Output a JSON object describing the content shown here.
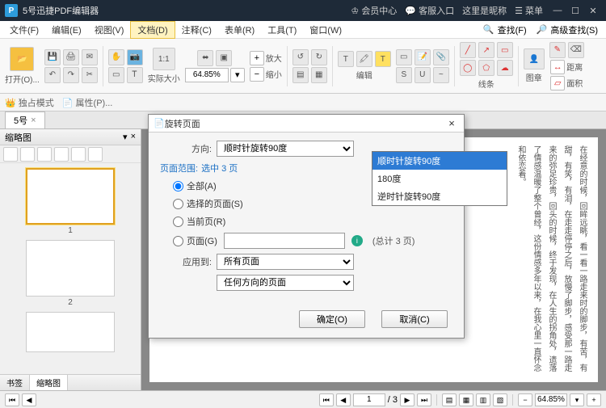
{
  "titlebar": {
    "app_title": "5号迅捷PDF编辑器",
    "member_center": "会员中心",
    "support": "客服入口",
    "nickname": "这里是昵称",
    "menu": "菜单"
  },
  "menubar": {
    "items": [
      "文件(F)",
      "编辑(E)",
      "视图(V)",
      "文档(D)",
      "注释(C)",
      "表单(R)",
      "工具(T)",
      "窗口(W)"
    ],
    "active_index": 3,
    "find": "查找(F)",
    "adv_find": "高级查找(S)"
  },
  "toolbar": {
    "open": "打开(O)...",
    "actual_size": "实际大小",
    "zoom_in": "放大",
    "zoom_out": "缩小",
    "edit": "编辑",
    "lines": "线条",
    "stamp": "图章",
    "distance": "距离",
    "area": "面积",
    "zoom_value": "64.85%"
  },
  "propbar": {
    "exclusive": "独占模式",
    "properties": "属性(P)..."
  },
  "tabs": {
    "doc": "5号"
  },
  "sidebar": {
    "title": "缩略图",
    "pages": [
      "1",
      "2"
    ],
    "foot_bookmark": "书签",
    "foot_thumbs": "缩略图"
  },
  "dialog": {
    "title": "旋转页面",
    "direction_label": "方向:",
    "direction_value": "顺时针旋转90度",
    "direction_options": [
      "顺时针旋转90度",
      "180度",
      "逆时针旋转90度"
    ],
    "range_label": "页面范围:",
    "range_info": "选中 3 页",
    "radio_all": "全部(A)",
    "radio_selected": "选择的页面(S)",
    "radio_current": "当前页(R)",
    "radio_pages": "页面(G)",
    "count_text": "(总计 3 页)",
    "apply_label": "应用到:",
    "apply_all_pages": "所有页面",
    "apply_orientation": "任何方向的页面",
    "ok": "确定(O)",
    "cancel": "取消(C)"
  },
  "statusbar": {
    "page_current": "1",
    "page_total": "/ 3",
    "zoom": "64.85%"
  },
  "doc_text": "在经意的时候，回眸远眺，看一看一路走来时的脚步，有苦，有甜，有笑，有泪，在走走停停之后，放慢了脚步，感受那一路走来的弥足珍贵，回头的时候，终于发现，在人生的拐角处，遗落了情感温暖了整个曾经，这份情感多年以来，在我心里一直怀念和依恋着。"
}
